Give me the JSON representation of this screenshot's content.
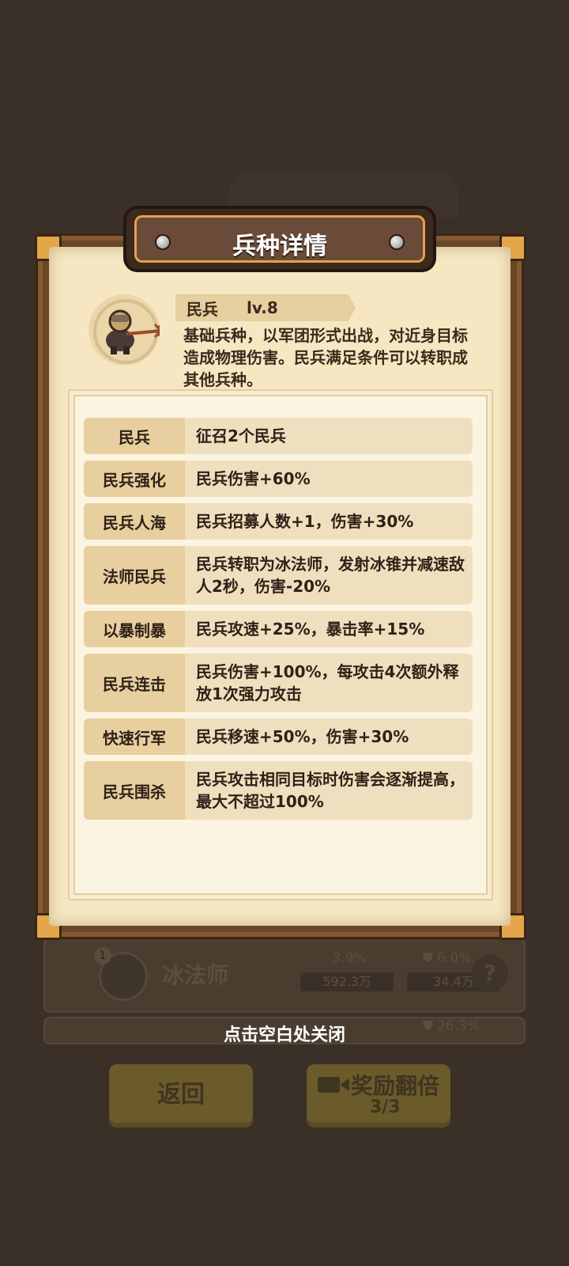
{
  "modal": {
    "title": "兵种详情",
    "unit_name": "民兵",
    "unit_level": "lv.8",
    "description": "基础兵种，以军团形式出战，对近身目标造成物理伤害。民兵满足条件可以转职成其他兵种。",
    "upgrades": [
      {
        "name": "民兵",
        "effect": "征召2个民兵"
      },
      {
        "name": "民兵强化",
        "effect": "民兵伤害+60%"
      },
      {
        "name": "民兵人海",
        "effect": "民兵招募人数+1，伤害+30%"
      },
      {
        "name": "法师民兵",
        "effect": "民兵转职为冰法师，发射冰锥并减速敌人2秒，伤害-20%"
      },
      {
        "name": "以暴制暴",
        "effect": "民兵攻速+25%，暴击率+15%"
      },
      {
        "name": "民兵连击",
        "effect": "民兵伤害+100%，每攻击4次额外释放1次强力攻击"
      },
      {
        "name": "快速行军",
        "effect": "民兵移速+50%，伤害+30%"
      },
      {
        "name": "民兵围杀",
        "effect": "民兵攻击相同目标时伤害会逐渐提高，最大不超过100%"
      }
    ],
    "close_hint": "点击空白处关闭"
  },
  "background": {
    "unit_row": {
      "level_badge": "1",
      "name": "冰法师",
      "attack_percent": "3.9%",
      "attack_value": "592.3万",
      "defense_percent": "6.0%",
      "defense_value": "34.4万",
      "help_icon": "?"
    },
    "partial_row": {
      "defense_percent": "26.3%"
    },
    "back_button": "返回",
    "reward_button": {
      "label": "奖励翻倍",
      "count": "3/3"
    }
  },
  "icons": {
    "rivet": "rivet-icon",
    "unit": "militia-pitchfork-icon",
    "attack": "sword-icon",
    "defense": "shield-icon",
    "help": "question-icon",
    "video": "camera-icon"
  },
  "colors": {
    "backdrop": "#3a3028",
    "frame": "#6b4726",
    "paper": "#f6e7c2",
    "row_name_bg": "#e8cf9f",
    "row_effect_bg": "#f0dfbe",
    "title_plate": "#6a4a38",
    "accent_gold": "#e6a04b"
  }
}
